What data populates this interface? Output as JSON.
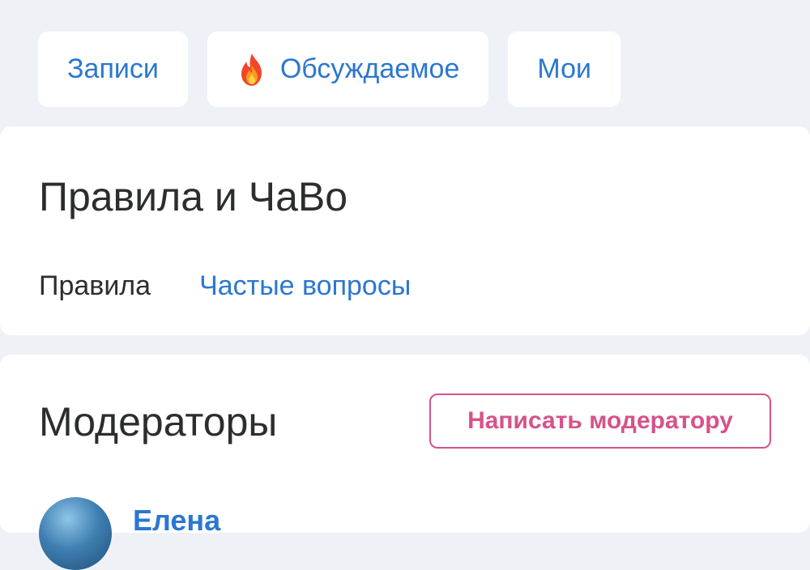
{
  "tabs": [
    {
      "label": "Записи",
      "icon": ""
    },
    {
      "label": "Обсуждаемое",
      "icon": "flame-icon"
    },
    {
      "label": "Мои",
      "icon": ""
    }
  ],
  "rules_card": {
    "title": "Правила и ЧаВо",
    "rules_label": "Правила",
    "faq_label": "Частые вопросы"
  },
  "moderators_card": {
    "title": "Модераторы",
    "write_button_label": "Написать модератору",
    "moderators": [
      {
        "name": "Елена"
      }
    ]
  },
  "colors": {
    "background": "#eef2f7",
    "card": "#ffffff",
    "link": "#2b77d1",
    "text": "#2c2d2e",
    "accent_pink": "#d7528a"
  }
}
